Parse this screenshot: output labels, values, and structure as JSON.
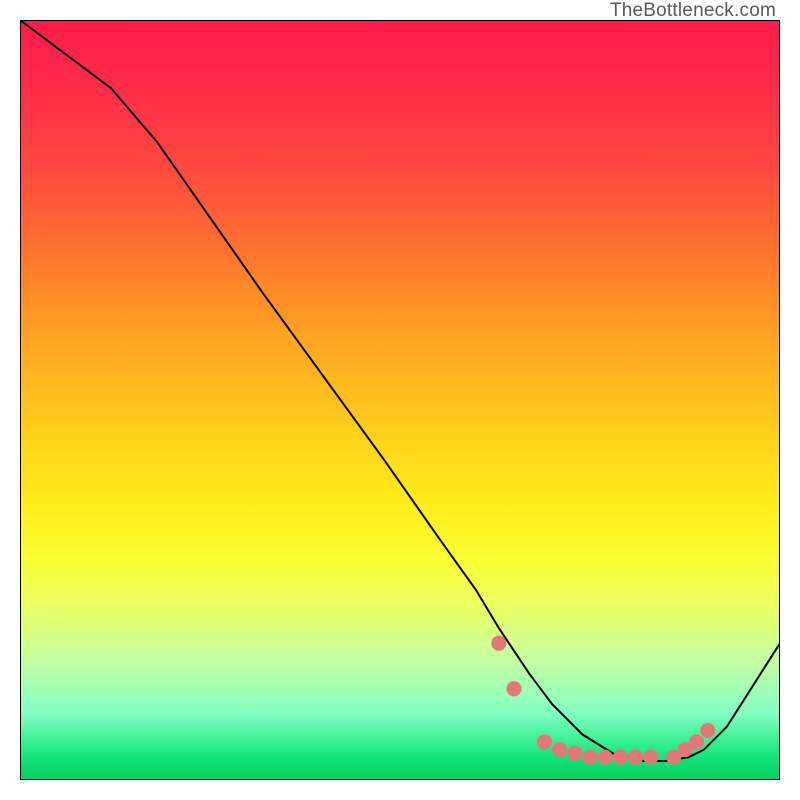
{
  "watermark": "TheBottleneck.com",
  "chart_data": {
    "type": "line",
    "title": "",
    "xlabel": "",
    "ylabel": "",
    "xlim": [
      0,
      100
    ],
    "ylim": [
      0,
      100
    ],
    "grid": false,
    "series": [
      {
        "name": "curve",
        "x": [
          0,
          4,
          8,
          12,
          18,
          25,
          32,
          40,
          48,
          55,
          60,
          63,
          65,
          67,
          70,
          74,
          78,
          82,
          85,
          88,
          90,
          93,
          100
        ],
        "y": [
          100,
          97,
          94,
          91,
          84,
          74,
          64,
          53,
          42,
          32,
          25,
          20,
          17,
          14,
          10,
          6,
          3.5,
          2.5,
          2.5,
          3,
          4,
          7,
          18
        ]
      }
    ],
    "highlight_points": {
      "name": "dots",
      "color": "#e07878",
      "x": [
        63,
        65,
        69,
        71,
        73,
        75,
        77,
        79,
        81,
        83,
        86,
        87.5,
        89,
        90.5
      ],
      "y": [
        18,
        12,
        5,
        4,
        3.5,
        3,
        3,
        3,
        3,
        3,
        3,
        4,
        5,
        6.5
      ]
    }
  }
}
